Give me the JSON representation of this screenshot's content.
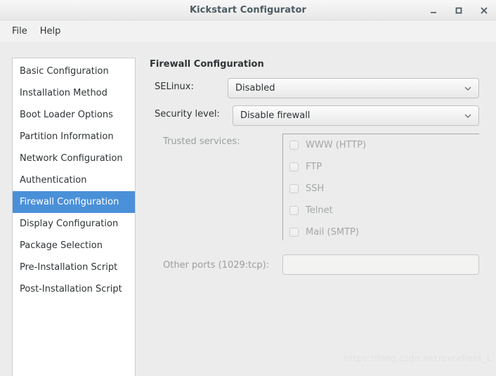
{
  "window": {
    "title": "Kickstart Configurator",
    "controls": [
      {
        "name": "minimize",
        "glyph": "_"
      },
      {
        "name": "maximize",
        "glyph": "□"
      },
      {
        "name": "close",
        "glyph": "✕"
      }
    ]
  },
  "menubar": {
    "items": [
      {
        "label": "File"
      },
      {
        "label": "Help"
      }
    ]
  },
  "sidebar": {
    "items": [
      {
        "label": "Basic Configuration",
        "selected": false
      },
      {
        "label": "Installation Method",
        "selected": false
      },
      {
        "label": "Boot Loader Options",
        "selected": false
      },
      {
        "label": "Partition Information",
        "selected": false
      },
      {
        "label": "Network Configuration",
        "selected": false
      },
      {
        "label": "Authentication",
        "selected": false
      },
      {
        "label": "Firewall Configuration",
        "selected": true
      },
      {
        "label": "Display Configuration",
        "selected": false
      },
      {
        "label": "Package Selection",
        "selected": false
      },
      {
        "label": "Pre-Installation Script",
        "selected": false
      },
      {
        "label": "Post-Installation Script",
        "selected": false
      }
    ]
  },
  "main": {
    "title": "Firewall Configuration",
    "selinux": {
      "label": "SELinux:",
      "value": "Disabled"
    },
    "security_level": {
      "label": "Security level:",
      "value": "Disable firewall"
    },
    "trusted_services": {
      "label": "Trusted services:",
      "enabled": false,
      "items": [
        {
          "label": "WWW (HTTP)",
          "checked": false
        },
        {
          "label": "FTP",
          "checked": false
        },
        {
          "label": "SSH",
          "checked": false
        },
        {
          "label": "Telnet",
          "checked": false
        },
        {
          "label": "Mail (SMTP)",
          "checked": false
        }
      ]
    },
    "other_ports": {
      "label": "Other ports (1029:tcp):",
      "value": "",
      "placeholder": ""
    }
  },
  "watermark": {
    "text": "https://blog.csdn.net/excellent_L"
  },
  "colors": {
    "accent": "#4a90d9",
    "window_bg": "#ececec",
    "list_bg": "#ffffff",
    "text": "#2e3436",
    "text_disabled": "#a4a7a8"
  }
}
